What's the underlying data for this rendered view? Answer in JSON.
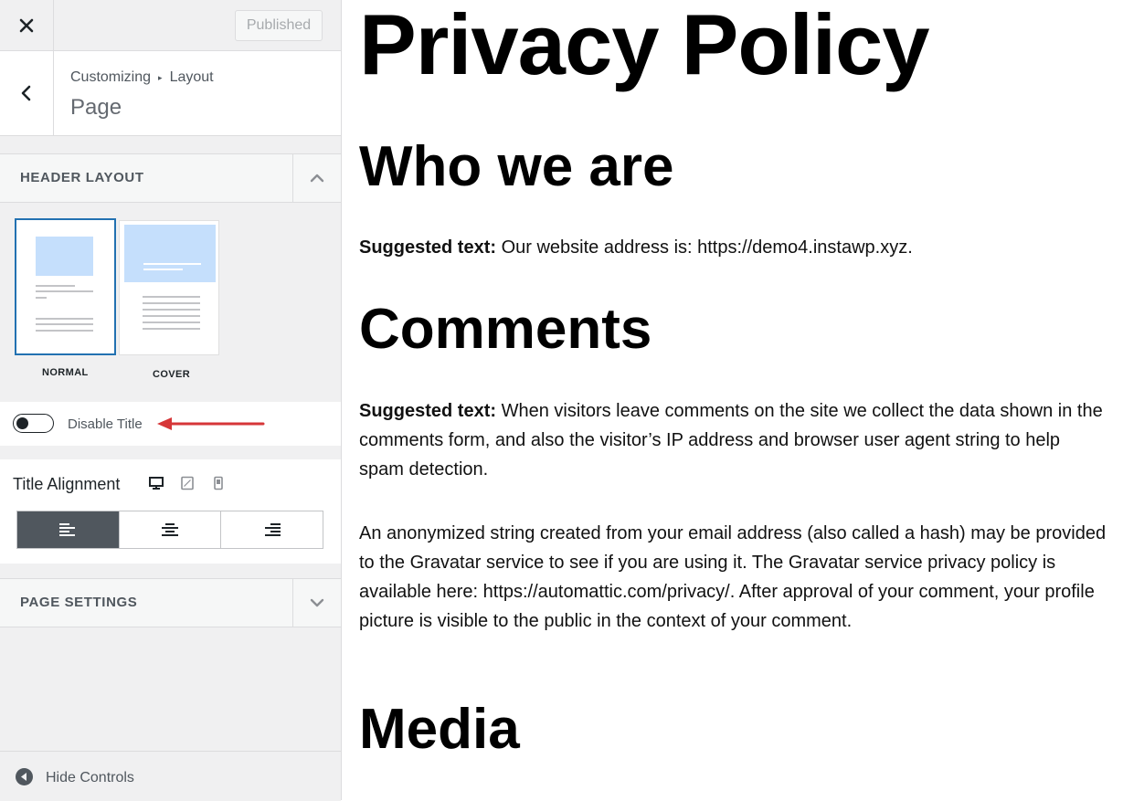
{
  "sidebar": {
    "publish_label": "Published",
    "breadcrumb": {
      "root": "Customizing",
      "parent": "Layout"
    },
    "panel_title": "Page",
    "header_layout": {
      "title": "HEADER LAYOUT",
      "options": [
        {
          "label": "NORMAL",
          "selected": true
        },
        {
          "label": "COVER",
          "selected": false
        }
      ]
    },
    "disable_title": {
      "label": "Disable Title",
      "enabled": false
    },
    "title_alignment": {
      "label": "Title Alignment",
      "devices": [
        "desktop-icon",
        "tablet-icon",
        "mobile-icon"
      ],
      "selected": "left"
    },
    "page_settings": {
      "title": "PAGE SETTINGS"
    },
    "hide_controls_label": "Hide Controls"
  },
  "preview": {
    "page_title": "Privacy Policy",
    "sections": [
      {
        "heading": "Who we are",
        "paragraphs": [
          {
            "bold": "Suggested text:",
            "text": " Our website address is: https://demo4.instawp.xyz."
          }
        ]
      },
      {
        "heading": "Comments",
        "paragraphs": [
          {
            "bold": "Suggested text:",
            "text": " When visitors leave comments on the site we collect the data shown in the comments form, and also the visitor’s IP address and browser user agent string to help spam detection."
          },
          {
            "bold": "",
            "text": "An anonymized string created from your email address (also called a hash) may be provided to the Gravatar service to see if you are using it. The Gravatar service privacy policy is available here: https://automattic.com/privacy/. After approval of your comment, your profile picture is visible to the public in the context of your comment."
          }
        ]
      },
      {
        "heading": "Media",
        "paragraphs": []
      }
    ]
  },
  "colors": {
    "accent": "#2271b1",
    "annotation_arrow": "#d63638",
    "active_button": "#50575e"
  }
}
